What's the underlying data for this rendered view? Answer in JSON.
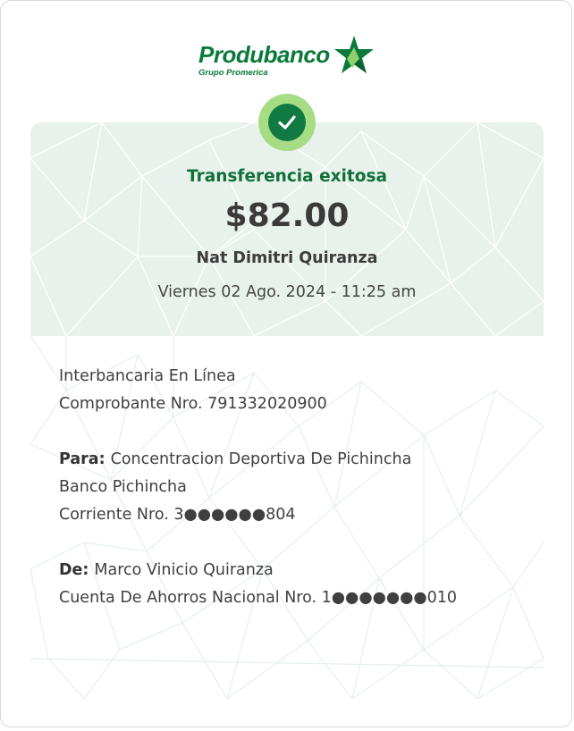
{
  "brand": {
    "name": "Produbanco",
    "group": "Grupo Promerica",
    "color": "#0a7a3a"
  },
  "status": {
    "icon": "check-circle-icon",
    "title": "Transferencia exitosa"
  },
  "amount": "$82.00",
  "beneficiary_name": "Nat Dimitri Quiranza",
  "datetime": "Viernes 02 Ago. 2024 - 11:25 am",
  "transfer": {
    "type": "Interbancaria En Línea",
    "receipt": "Comprobante Nro. 791332020900"
  },
  "to": {
    "label": "Para:",
    "name": "Concentracion Deportiva De Pichincha",
    "bank": "Banco Pichincha",
    "account": "Corriente Nro. 3●●●●●●804"
  },
  "from": {
    "label": "De:",
    "name": "Marco Vinicio Quiranza",
    "account": "Cuenta De Ahorros Nacional Nro. 1●●●●●●●010"
  },
  "colors": {
    "accent_green": "#0f7038",
    "badge_light": "#a6dd84",
    "hero_background": "#e9f1ec"
  }
}
